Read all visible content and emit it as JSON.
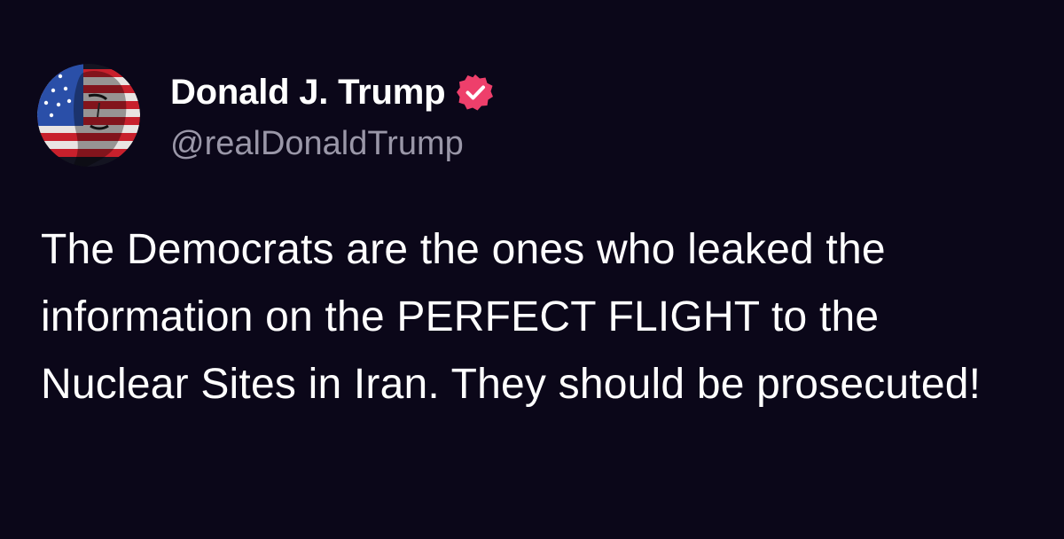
{
  "post": {
    "author": {
      "display_name": "Donald J. Trump",
      "handle": "@realDonaldTrump",
      "verified_icon": "verified-badge-icon",
      "avatar_icon": "flag-portrait-avatar"
    },
    "text": "The Democrats are the ones who leaked the information on the PERFECT FLIGHT to the Nuclear Sites in Iran. They should be prosecuted!"
  },
  "colors": {
    "background": "#0b0719",
    "text": "#ffffff",
    "handle": "#9a97a8",
    "badge": "#ee3f6b"
  }
}
